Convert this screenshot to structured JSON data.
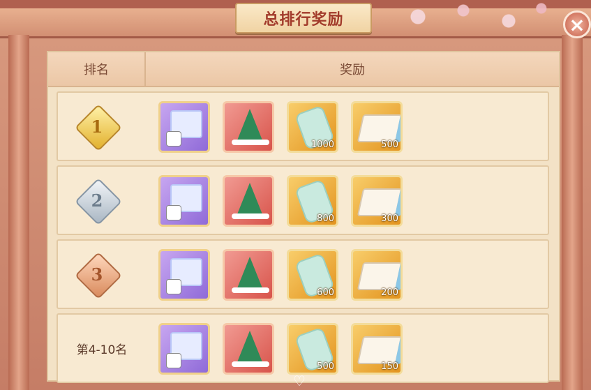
{
  "title": "总排行奖励",
  "header": {
    "rank_label": "排名",
    "reward_label": "奖励"
  },
  "close_glyph": "×",
  "rows": [
    {
      "rank": "1",
      "counts": {
        "jade": "1000",
        "scroll": "500"
      }
    },
    {
      "rank": "2",
      "counts": {
        "jade": "800",
        "scroll": "300"
      }
    },
    {
      "rank": "3",
      "counts": {
        "jade": "600",
        "scroll": "200"
      }
    },
    {
      "rank": "第4-10名",
      "counts": {
        "jade": "500",
        "scroll": "150"
      }
    }
  ],
  "icons": [
    "gift-box-icon",
    "christmas-tree-icon",
    "jade-token-icon",
    "scroll-icon"
  ],
  "colors": {
    "title": "#a23b2b",
    "accent_gold": "#e3941f",
    "panel": "#f3e2c6"
  }
}
